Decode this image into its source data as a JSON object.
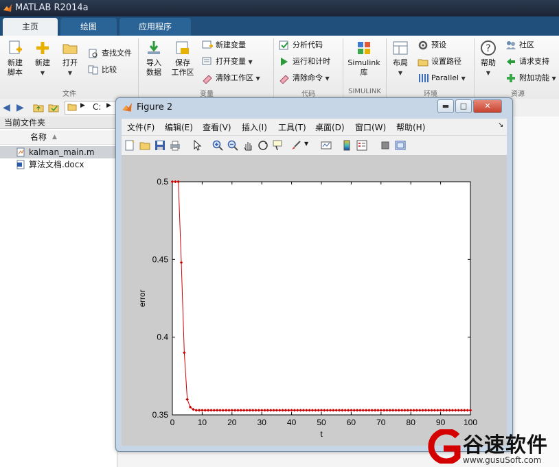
{
  "window": {
    "title": "MATLAB R2014a"
  },
  "tabs": [
    {
      "label": "主页",
      "active": true
    },
    {
      "label": "绘图",
      "active": false
    },
    {
      "label": "应用程序",
      "active": false
    }
  ],
  "ribbon": {
    "file": {
      "new_script": "新建\n脚本",
      "new": "新建",
      "open": "打开",
      "find_files": "查找文件",
      "compare": "比较",
      "group": "文件"
    },
    "variable": {
      "import": "导入\n数据",
      "save": "保存\n工作区",
      "new_var": "新建变量",
      "open_var": "打开变量",
      "clear_ws": "清除工作区",
      "group": "变量"
    },
    "code": {
      "analyze": "分析代码",
      "run_time": "运行和计时",
      "clear_cmd": "清除命令",
      "group": "代码"
    },
    "simulink": {
      "lib": "Simulink\n库",
      "group": "SIMULINK"
    },
    "env": {
      "layout": "布局",
      "prefs": "预设",
      "set_path": "设置路径",
      "parallel": "Parallel",
      "group": "环境"
    },
    "resources": {
      "help": "帮助",
      "community": "社区",
      "support": "请求支持",
      "addons": "附加功能",
      "group": "资源"
    }
  },
  "navbar": {
    "path": "C:"
  },
  "left_panel": {
    "title": "当前文件夹",
    "col_name": "名称",
    "files": [
      {
        "name": "kalman_main.m",
        "selected": true
      },
      {
        "name": "算法文档.docx",
        "selected": false
      }
    ]
  },
  "figure": {
    "title": "Figure 2",
    "menu": [
      "文件(F)",
      "编辑(E)",
      "查看(V)",
      "插入(I)",
      "工具(T)",
      "桌面(D)",
      "窗口(W)",
      "帮助(H)"
    ],
    "toolbar_icons": [
      "new-figure-icon",
      "open-file-icon",
      "save-icon",
      "print-icon",
      "pointer-icon",
      "zoom-in-icon",
      "zoom-out-icon",
      "pan-icon",
      "rotate-3d-icon",
      "data-cursor-icon",
      "brush-icon",
      "link-plot-icon",
      "colorbar-icon",
      "legend-icon",
      "hide-plot-tools-icon",
      "show-plot-tools-icon"
    ]
  },
  "chart_data": {
    "type": "line",
    "title": "",
    "xlabel": "t",
    "ylabel": "error",
    "xlim": [
      0,
      100
    ],
    "ylim": [
      0.35,
      0.5
    ],
    "xticks": [
      0,
      10,
      20,
      30,
      40,
      50,
      60,
      70,
      80,
      90,
      100
    ],
    "yticks": [
      0.35,
      0.4,
      0.45,
      0.5
    ],
    "ytick_labels": [
      "0.35",
      "0.4",
      "0.45",
      "0.5"
    ],
    "grid": false,
    "series": [
      {
        "color": "#cc0000",
        "marker": "diamond",
        "x": [
          0,
          1,
          2,
          3,
          4,
          5,
          6,
          7,
          8,
          9,
          10,
          11,
          12,
          13,
          14,
          15,
          16,
          17,
          18,
          19,
          20,
          21,
          22,
          23,
          24,
          25,
          26,
          27,
          28,
          29,
          30,
          31,
          32,
          33,
          34,
          35,
          36,
          37,
          38,
          39,
          40,
          41,
          42,
          43,
          44,
          45,
          46,
          47,
          48,
          49,
          50,
          51,
          52,
          53,
          54,
          55,
          56,
          57,
          58,
          59,
          60,
          61,
          62,
          63,
          64,
          65,
          66,
          67,
          68,
          69,
          70,
          71,
          72,
          73,
          74,
          75,
          76,
          77,
          78,
          79,
          80,
          81,
          82,
          83,
          84,
          85,
          86,
          87,
          88,
          89,
          90,
          91,
          92,
          93,
          94,
          95,
          96,
          97,
          98,
          99,
          100
        ],
        "y": [
          0.5,
          0.5,
          0.5,
          0.448,
          0.39,
          0.36,
          0.355,
          0.3535,
          0.353,
          0.353,
          0.353,
          0.353,
          0.353,
          0.353,
          0.353,
          0.353,
          0.353,
          0.353,
          0.353,
          0.353,
          0.353,
          0.353,
          0.353,
          0.353,
          0.353,
          0.353,
          0.353,
          0.353,
          0.353,
          0.353,
          0.353,
          0.353,
          0.353,
          0.353,
          0.353,
          0.353,
          0.353,
          0.353,
          0.353,
          0.353,
          0.353,
          0.353,
          0.353,
          0.353,
          0.353,
          0.353,
          0.353,
          0.353,
          0.353,
          0.353,
          0.353,
          0.353,
          0.353,
          0.353,
          0.353,
          0.353,
          0.353,
          0.353,
          0.353,
          0.353,
          0.353,
          0.353,
          0.353,
          0.353,
          0.353,
          0.353,
          0.353,
          0.353,
          0.353,
          0.353,
          0.353,
          0.353,
          0.353,
          0.353,
          0.353,
          0.353,
          0.353,
          0.353,
          0.353,
          0.353,
          0.353,
          0.353,
          0.353,
          0.353,
          0.353,
          0.353,
          0.353,
          0.353,
          0.353,
          0.353,
          0.353,
          0.353,
          0.353,
          0.353,
          0.353,
          0.353,
          0.353,
          0.353,
          0.353,
          0.353,
          0.353
        ]
      }
    ]
  },
  "watermark": {
    "brand": "谷速软件",
    "url": "www.gusuSoft.com"
  }
}
